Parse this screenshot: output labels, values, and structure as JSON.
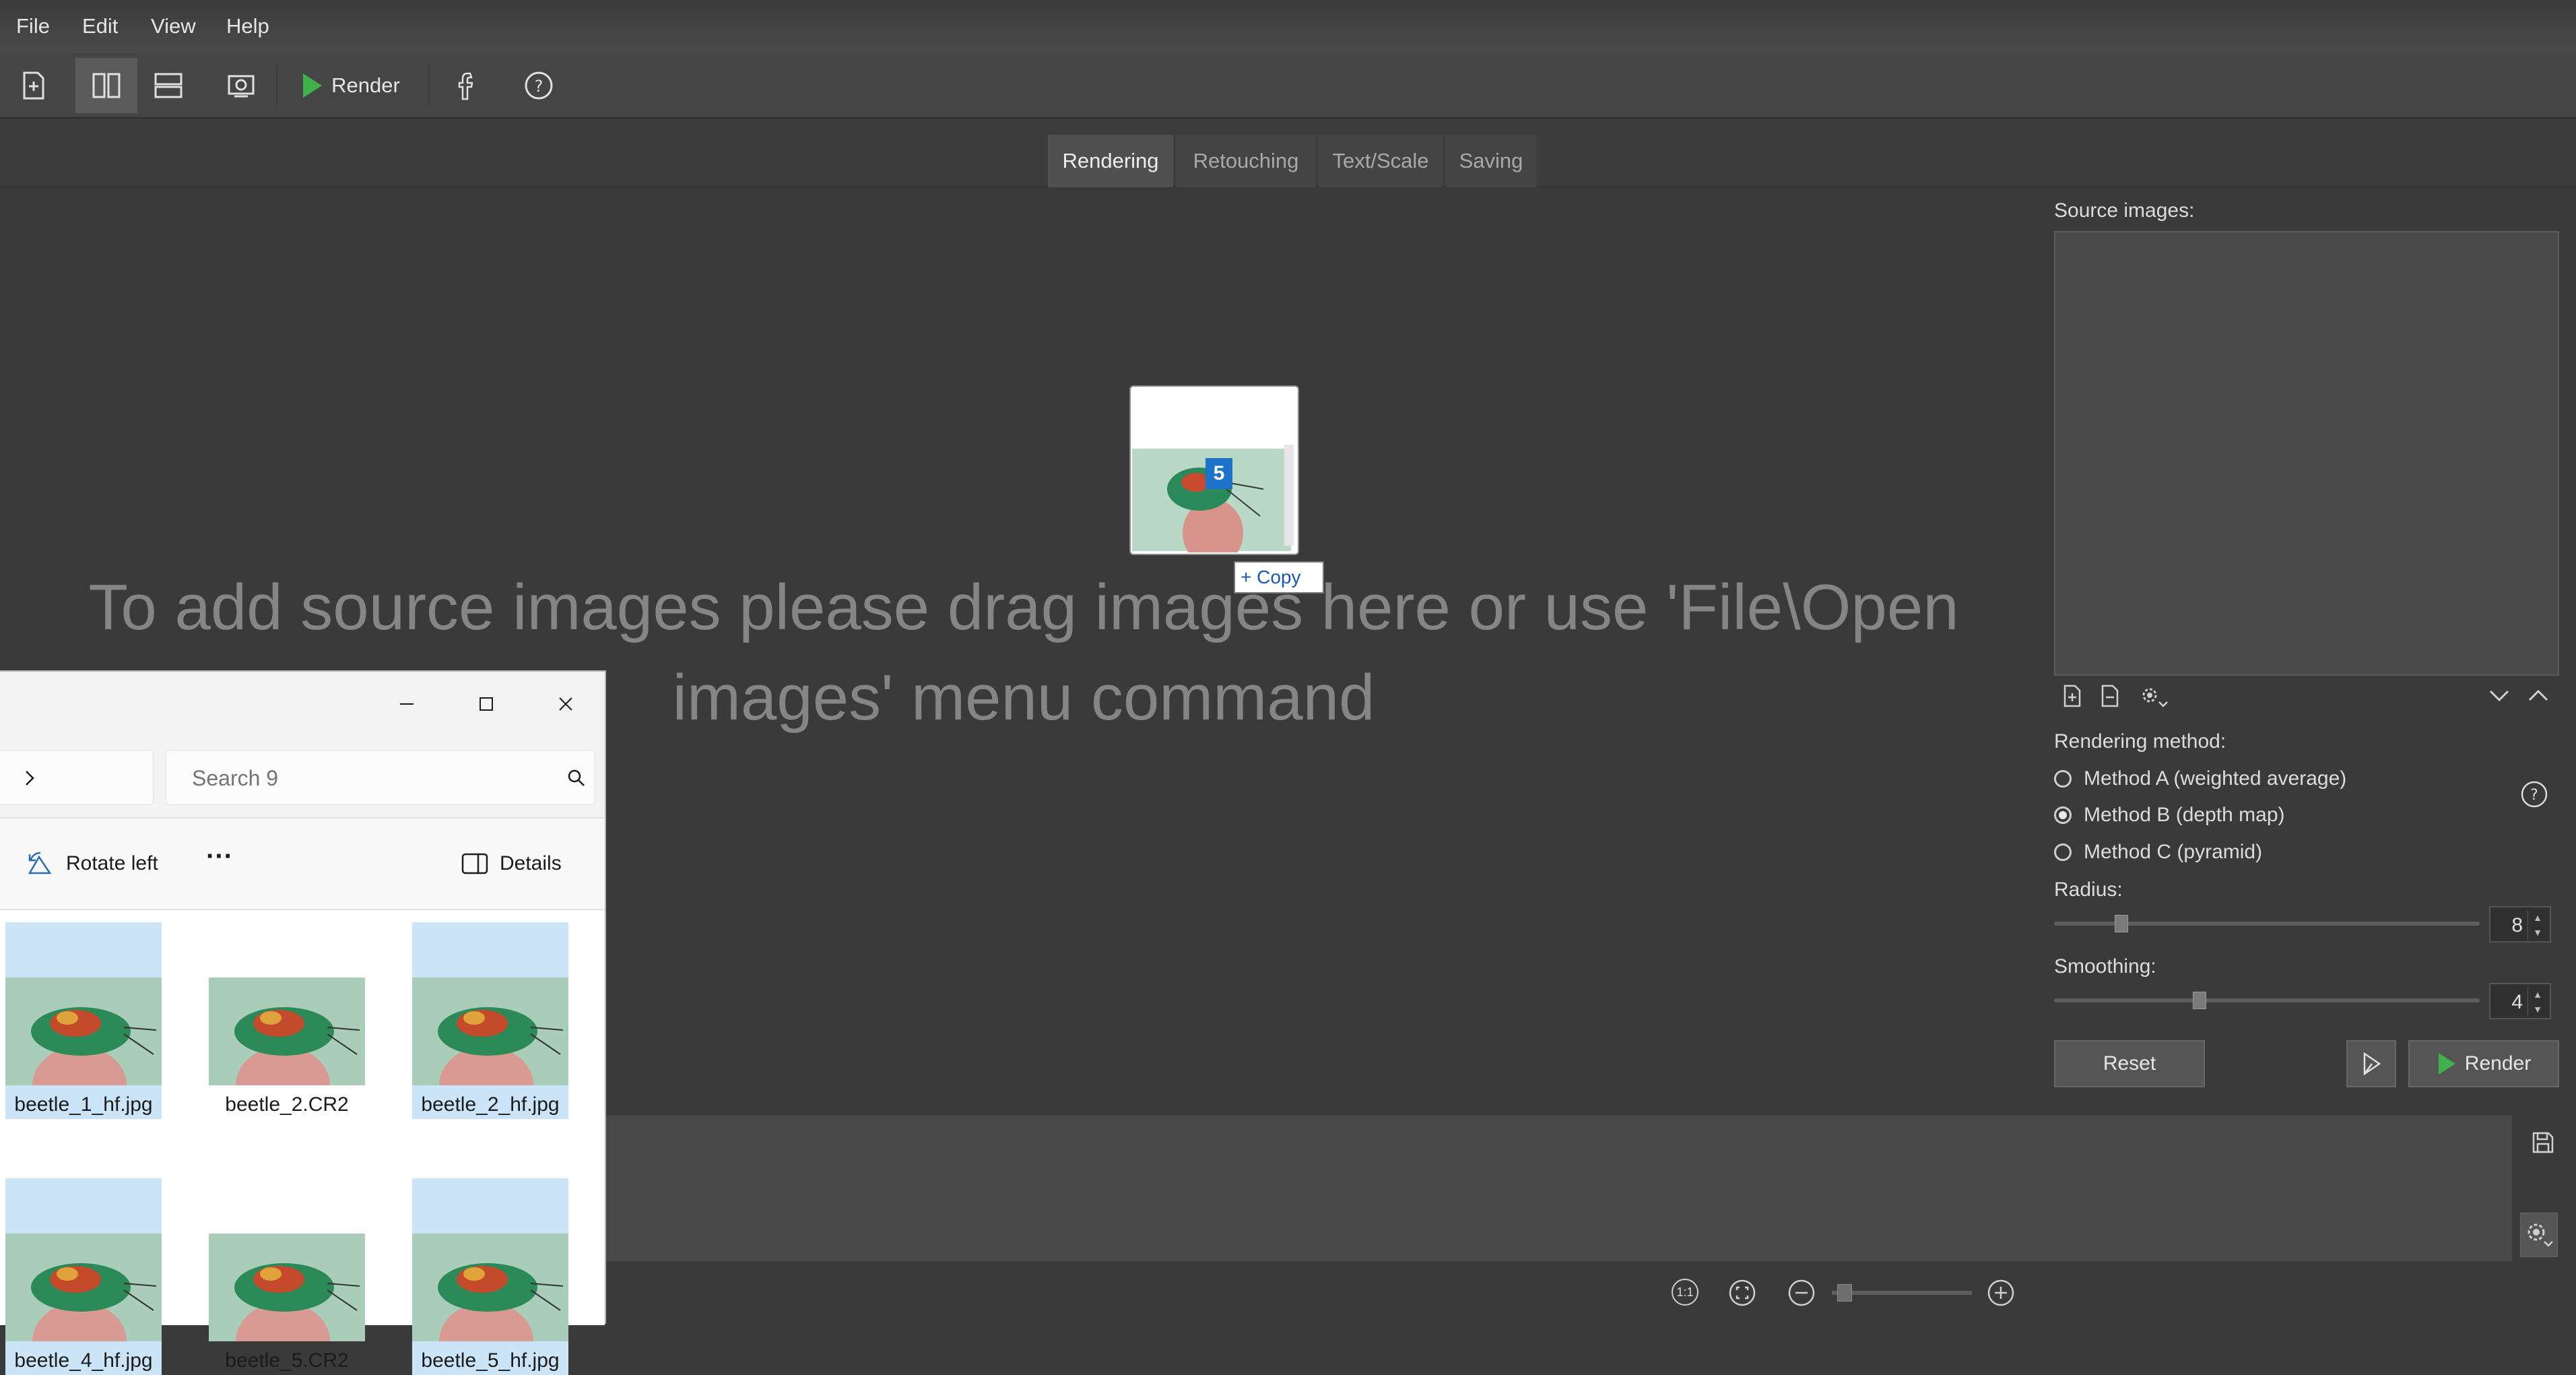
{
  "menu": [
    "File",
    "Edit",
    "View",
    "Help"
  ],
  "toolbar": {
    "render_label": "Render"
  },
  "tabs": [
    {
      "label": "Rendering",
      "active": true
    },
    {
      "label": "Retouching",
      "active": false
    },
    {
      "label": "Text/Scale",
      "active": false
    },
    {
      "label": "Saving",
      "active": false
    }
  ],
  "canvas": {
    "drop_hint": "To add source images please drag images here or use 'File\\Open images' menu command",
    "drag_count": "5",
    "copy_tooltip": "+ Copy"
  },
  "panel": {
    "source_images_label": "Source images:",
    "rendering_method_label": "Rendering method:",
    "methods": [
      {
        "label": "Method A (weighted average)",
        "selected": false
      },
      {
        "label": "Method B (depth map)",
        "selected": true
      },
      {
        "label": "Method C (pyramid)",
        "selected": false
      }
    ],
    "radius_label": "Radius:",
    "radius_value": "8",
    "smoothing_label": "Smoothing:",
    "smoothing_value": "4",
    "reset_label": "Reset",
    "render_label": "Render"
  },
  "explorer": {
    "search_placeholder": "Search 9",
    "rotate_left_label": "Rotate left",
    "more_label": "···",
    "details_label": "Details",
    "files": [
      {
        "name": "beetle_1_hf.jpg",
        "selected": true
      },
      {
        "name": "beetle_2.CR2",
        "selected": false
      },
      {
        "name": "beetle_2_hf.jpg",
        "selected": true
      },
      {
        "name": "beetle_4_hf.jpg",
        "selected": true
      },
      {
        "name": "beetle_5.CR2",
        "selected": false
      },
      {
        "name": "beetle_5_hf.jpg",
        "selected": true
      }
    ]
  },
  "statusbar": {
    "actual_size_label": "1:1"
  },
  "colors": {
    "accent_green": "#3fb04a",
    "selection_blue": "#cce4f7",
    "badge_blue": "#1d72c9"
  }
}
